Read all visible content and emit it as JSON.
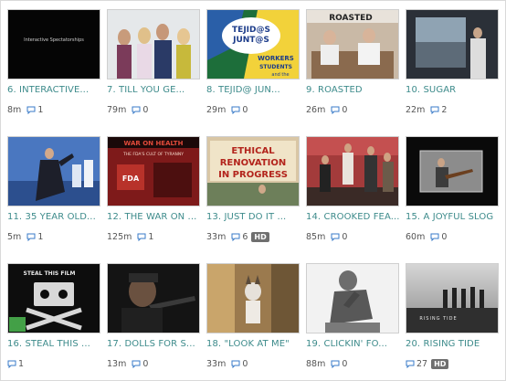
{
  "colors": {
    "title": "#3d8b8b",
    "meta": "#555555",
    "comment_icon": "#3a7bc8",
    "hd_badge": "#6f6f6f",
    "view_badge": "#43a047"
  },
  "videos": [
    {
      "title": "6. INTERACTIVE...",
      "duration": "8m",
      "comments": "1",
      "thumb_text": "Interactive Spectatorships"
    },
    {
      "title": "7. TILL YOU GE...",
      "duration": "79m",
      "comments": "0"
    },
    {
      "title": "8. TEJID@ JUN...",
      "duration": "29m",
      "comments": "0",
      "thumb_text": "TEJID@S JUNT@S WORKERS STUDENTS and the"
    },
    {
      "title": "9. ROASTED",
      "duration": "26m",
      "comments": "0",
      "thumb_text": "ROASTED"
    },
    {
      "title": "10. SUGAR",
      "duration": "22m",
      "comments": "2"
    },
    {
      "title": "11. 35 YEAR OLD...",
      "duration": "5m",
      "comments": "1"
    },
    {
      "title": "12. THE WAR ON ...",
      "duration": "125m",
      "comments": "1",
      "thumb_text": "WAR ON HEALTH THE FDA'S CULT OF TYRANNY"
    },
    {
      "title": "13. JUST DO IT ...",
      "duration": "33m",
      "comments": "6",
      "hd": "HD",
      "thumb_text": "ETHICAL RENOVATION IN PROGRESS"
    },
    {
      "title": "14. CROOKED FEA...",
      "duration": "85m",
      "comments": "0"
    },
    {
      "title": "15. A JOYFUL SLOG",
      "duration": "60m",
      "comments": "0"
    },
    {
      "title": "16. STEAL THIS ...",
      "duration": "",
      "comments": "1",
      "thumb_text": "STEAL THIS FILM",
      "view_badge": true
    },
    {
      "title": "17. DOLLS FOR S...",
      "duration": "13m",
      "comments": "0"
    },
    {
      "title": "18. \"LOOK AT ME\"",
      "duration": "33m",
      "comments": "0"
    },
    {
      "title": "19. CLICKIN' FO...",
      "duration": "88m",
      "comments": "0"
    },
    {
      "title": "20. RISING TIDE",
      "duration": "",
      "comments": "27",
      "hd": "HD",
      "thumb_text": "RISING TIDE"
    }
  ]
}
